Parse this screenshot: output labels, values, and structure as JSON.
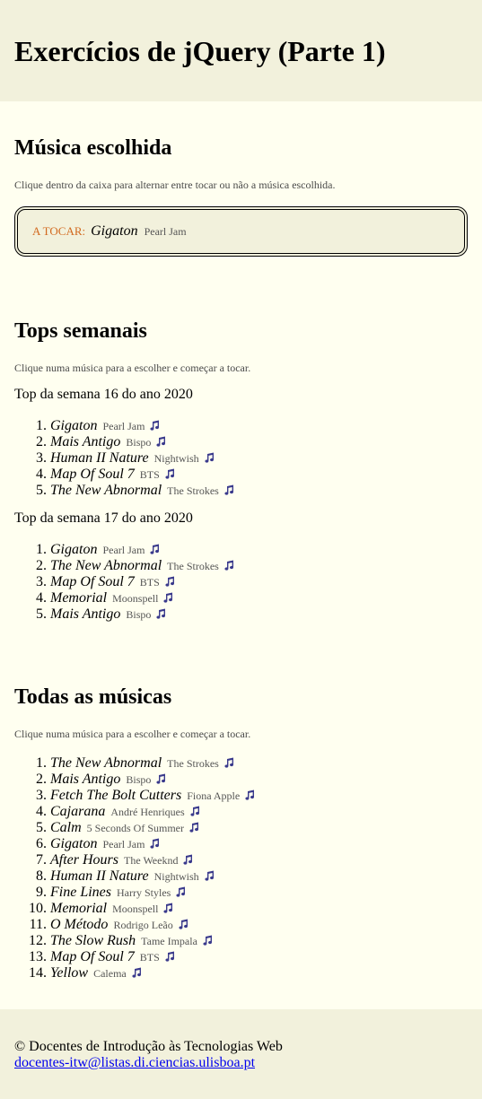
{
  "header": {
    "title": "Exercícios de jQuery (Parte 1)"
  },
  "escolhida": {
    "heading": "Música escolhida",
    "instruction": "Clique dentro da caixa para alternar entre tocar ou não a música escolhida.",
    "status": "A TOCAR:",
    "title": "Gigaton",
    "artist": "Pearl Jam"
  },
  "tops": {
    "heading": "Tops semanais",
    "instruction": "Clique numa música para a escolher e começar a tocar.",
    "weeks": [
      {
        "title": "Top da semana 16 do ano 2020",
        "songs": [
          {
            "title": "Gigaton",
            "artist": "Pearl Jam"
          },
          {
            "title": "Mais Antigo",
            "artist": "Bispo"
          },
          {
            "title": "Human II Nature",
            "artist": "Nightwish"
          },
          {
            "title": "Map Of Soul 7",
            "artist": "BTS"
          },
          {
            "title": "The New Abnormal",
            "artist": "The Strokes"
          }
        ]
      },
      {
        "title": "Top da semana 17 do ano 2020",
        "songs": [
          {
            "title": "Gigaton",
            "artist": "Pearl Jam"
          },
          {
            "title": "The New Abnormal",
            "artist": "The Strokes"
          },
          {
            "title": "Map Of Soul 7",
            "artist": "BTS"
          },
          {
            "title": "Memorial",
            "artist": "Moonspell"
          },
          {
            "title": "Mais Antigo",
            "artist": "Bispo"
          }
        ]
      }
    ]
  },
  "todas": {
    "heading": "Todas as músicas",
    "instruction": "Clique numa música para a escolher e começar a tocar.",
    "songs": [
      {
        "title": "The New Abnormal",
        "artist": "The Strokes"
      },
      {
        "title": "Mais Antigo",
        "artist": "Bispo"
      },
      {
        "title": "Fetch The Bolt Cutters",
        "artist": "Fiona Apple"
      },
      {
        "title": "Cajarana",
        "artist": "André Henriques"
      },
      {
        "title": "Calm",
        "artist": "5 Seconds Of Summer"
      },
      {
        "title": "Gigaton",
        "artist": "Pearl Jam"
      },
      {
        "title": "After Hours",
        "artist": "The Weeknd"
      },
      {
        "title": "Human II Nature",
        "artist": "Nightwish"
      },
      {
        "title": "Fine Lines",
        "artist": "Harry Styles"
      },
      {
        "title": "Memorial",
        "artist": "Moonspell"
      },
      {
        "title": "O Método",
        "artist": "Rodrigo Leão"
      },
      {
        "title": "The Slow Rush",
        "artist": "Tame Impala"
      },
      {
        "title": "Map Of Soul 7",
        "artist": "BTS"
      },
      {
        "title": "Yellow",
        "artist": "Calema"
      }
    ]
  },
  "footer": {
    "copyright": "© Docentes de Introdução às Tecnologias Web",
    "email": "docentes-itw@listas.di.ciencias.ulisboa.pt"
  },
  "icons": {
    "song_icon": "music-note-icon"
  },
  "colors": {
    "status": "#d2691e",
    "note_icon": "#3a3a8c",
    "panel_bg": "#f2f1dc",
    "page_bg": "#fffff0"
  }
}
